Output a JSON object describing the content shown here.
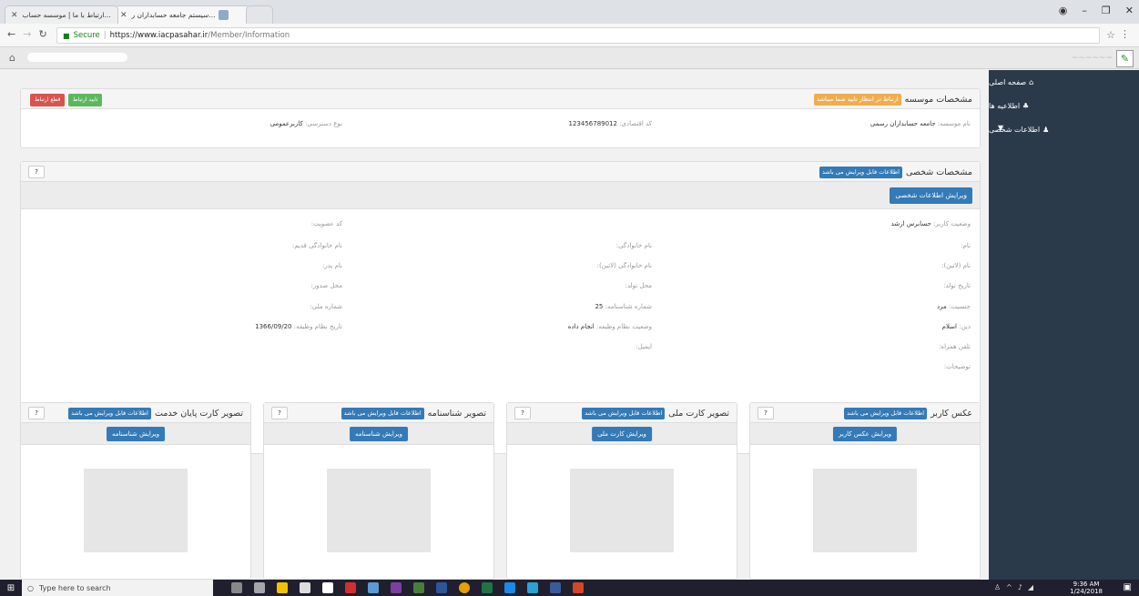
{
  "browser": {
    "tabs": [
      {
        "label": "سیستم جامعه حسابداران ر..."
      },
      {
        "label": "ارتباط با ما | موسسه حساب..."
      }
    ],
    "url_secure": "Secure",
    "url_domain": "https://www.iacpasahar.ir",
    "url_path": "/Member/Information"
  },
  "sidebar": {
    "items": [
      {
        "label": "صفحه اصلی",
        "icon": "home-icon"
      },
      {
        "label": "اطلاعیه ها",
        "icon": "bell-icon"
      },
      {
        "label": "اطلاعات شخصی",
        "icon": "user-icon"
      }
    ]
  },
  "institute": {
    "title": "مشخصات موسسه",
    "status_badge": "ارتباط در انتظار تایید شما میباشد",
    "confirm_btn": "تایید ارتباط",
    "cut_btn": "قطع ارتباط",
    "name_label": "نام موسسه:",
    "name_value": "جامعه حسابداران رسمی",
    "eco_label": "کد اقتصادی:",
    "eco_value": "123456789012",
    "access_label": "نوع دسترسی:",
    "access_value": "کاربرعمومی"
  },
  "personal": {
    "title": "مشخصات شخصی",
    "editable_badge": "اطلاعات قابل ویرایش می باشد",
    "edit_btn": "ویرایش اطلاعات شخصی",
    "help": "?",
    "fields": {
      "status_label": "وضعیت کاربر:",
      "status_value": "حسابرس ارشد",
      "member_label": "کد عضویت:",
      "member_value": "",
      "name_label": "نام:",
      "name_value": "",
      "family_label": "نام خانوادگی:",
      "family_value": "",
      "oldfamily_label": "نام خانوادگی قدیم:",
      "oldfamily_value": "",
      "latin_label": "نام (لاتین):",
      "latin_value": "",
      "familylatin_label": "نام خانوادگی (لاتین):",
      "familylatin_value": "",
      "father_label": "نام پدر:",
      "father_value": "",
      "birthdate_label": "تاریخ تولد:",
      "birthdate_value": "",
      "birthplace_label": "محل تولد:",
      "birthplace_value": "",
      "issue_label": "محل صدور:",
      "issue_value": "",
      "gender_label": "جنسیت:",
      "gender_value": "مرد",
      "idno_label": "شماره شناسنامه:",
      "idno_value": "25",
      "national_label": "شماره ملی:",
      "national_value": "",
      "religion_label": "دین:",
      "religion_value": "اسلام",
      "military_label": "وضعیت نظام وظیفه:",
      "military_value": "انجام داده",
      "militarydate_label": "تاریخ نظام وظیفه:",
      "militarydate_value": "1366/09/20",
      "mobile_label": "تلفن همراه:",
      "mobile_value": "",
      "email_label": "ایمیل:",
      "email_value": "",
      "desc_label": "توضیحات:",
      "desc_value": ""
    }
  },
  "cards": [
    {
      "title": "عکس کاربر",
      "badge": "اطلاعات قابل ویرایش می باشد",
      "btn": "ویرایش عکس کاربر"
    },
    {
      "title": "تصویر کارت ملی",
      "badge": "اطلاعات قابل ویرایش می باشد",
      "btn": "ویرایش کارت ملی"
    },
    {
      "title": "تصویر شناسنامه",
      "badge": "اطلاعات قابل ویرایش می باشد",
      "btn": "ویرایش شناسنامه"
    },
    {
      "title": "تصویر کارت پایان خدمت",
      "badge": "اطلاعات قابل ویرایش می باشد",
      "btn": "ویرایش شناسنامه"
    }
  ],
  "taskbar": {
    "search_placeholder": "Type here to search",
    "time": "9:36 AM",
    "date": "1/24/2018"
  }
}
